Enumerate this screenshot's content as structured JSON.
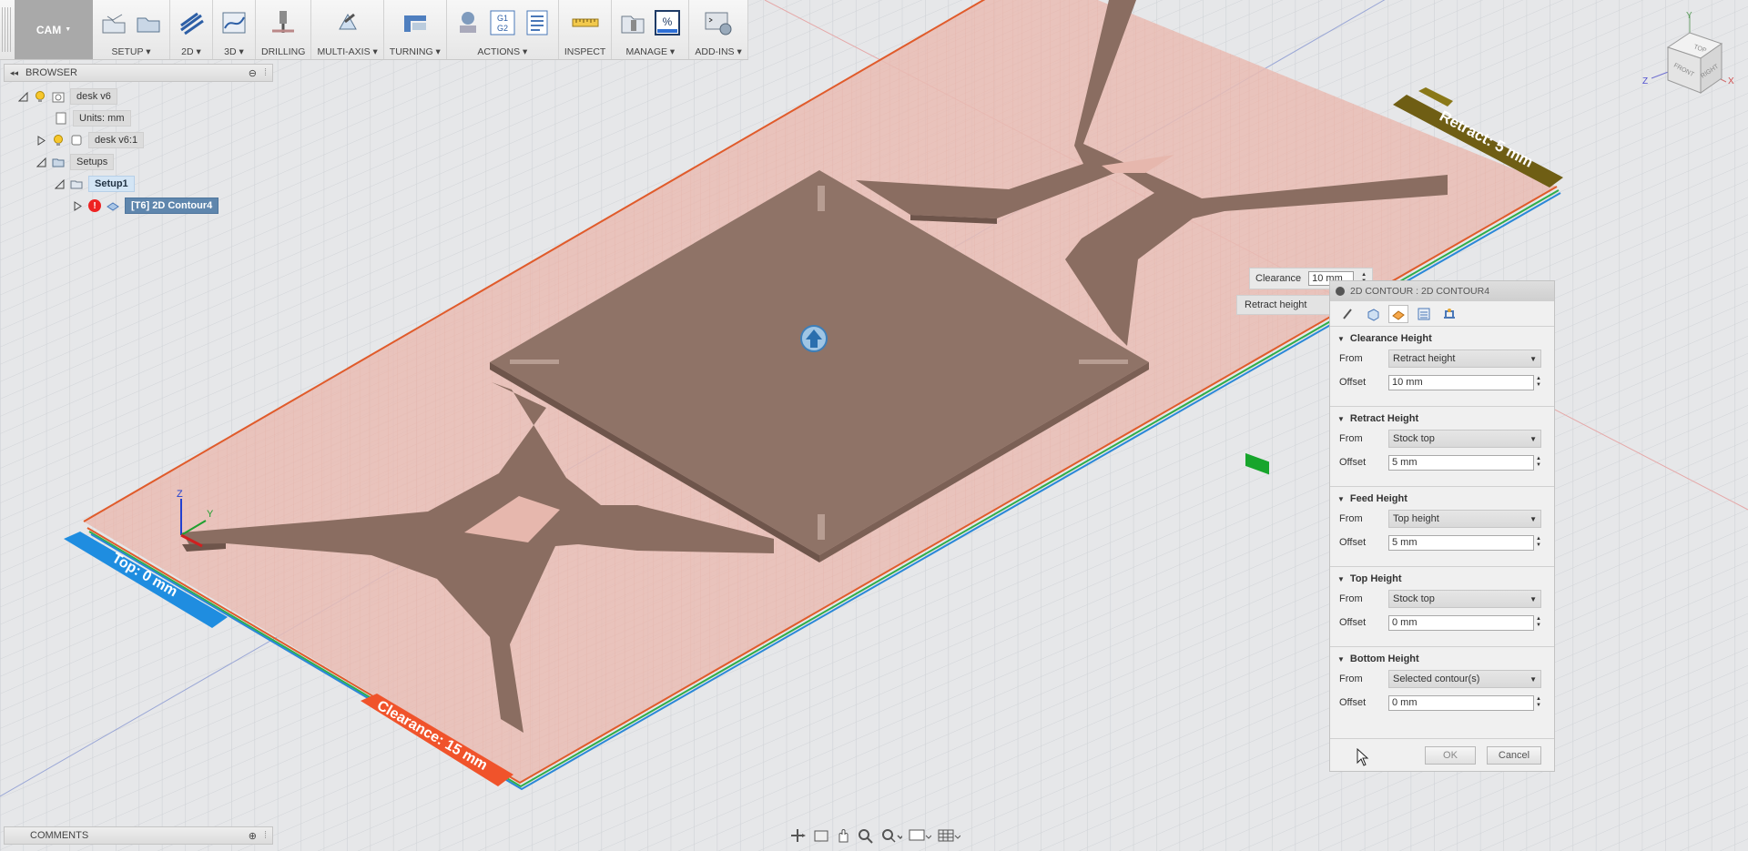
{
  "toolbar": {
    "workspace": "CAM",
    "groups": [
      {
        "label": "SETUP",
        "dropdown": true
      },
      {
        "label": "2D",
        "dropdown": true
      },
      {
        "label": "3D",
        "dropdown": true
      },
      {
        "label": "DRILLING",
        "dropdown": false
      },
      {
        "label": "MULTI-AXIS",
        "dropdown": true
      },
      {
        "label": "TURNING",
        "dropdown": true
      },
      {
        "label": "ACTIONS",
        "dropdown": true
      },
      {
        "label": "INSPECT",
        "dropdown": false
      },
      {
        "label": "MANAGE",
        "dropdown": true
      },
      {
        "label": "ADD-INS",
        "dropdown": true
      }
    ],
    "gcode_icon": {
      "line1": "G1",
      "line2": "G2"
    },
    "percent_icon": "%"
  },
  "browser": {
    "title": "BROWSER",
    "nodes": [
      {
        "label": "desk v6"
      },
      {
        "label": "Units: mm"
      },
      {
        "label": "desk v6:1"
      },
      {
        "label": "Setups"
      },
      {
        "label": "Setup1"
      },
      {
        "label": "[T6] 2D Contour4",
        "error": "!"
      }
    ]
  },
  "comments": {
    "title": "COMMENTS"
  },
  "viewport": {
    "labels": {
      "retract": "Retract: 5 mm",
      "top": "Top: 0 mm",
      "clearance": "Clearance: 15 mm"
    },
    "axis": {
      "z": "Z",
      "y": "Y"
    }
  },
  "viewcube": {
    "top": "TOP",
    "front": "FRONT",
    "right": "RIGHT",
    "x": "X",
    "y": "Y",
    "z": "Z"
  },
  "tooltip": {
    "clearance_label": "Clearance",
    "clearance_value": "10 mm",
    "retract_label": "Retract height"
  },
  "dialog": {
    "title": "2D CONTOUR : 2D CONTOUR4",
    "sections": [
      {
        "title": "Clearance Height",
        "from_label": "From",
        "from": "Retract height",
        "offset_label": "Offset",
        "offset": "10 mm"
      },
      {
        "title": "Retract Height",
        "from_label": "From",
        "from": "Stock top",
        "offset_label": "Offset",
        "offset": "5 mm"
      },
      {
        "title": "Feed Height",
        "from_label": "From",
        "from": "Top height",
        "offset_label": "Offset",
        "offset": "5 mm"
      },
      {
        "title": "Top Height",
        "from_label": "From",
        "from": "Stock top",
        "offset_label": "Offset",
        "offset": "0 mm"
      },
      {
        "title": "Bottom Height",
        "from_label": "From",
        "from": "Selected contour(s)",
        "offset_label": "Offset",
        "offset": "0 mm"
      }
    ],
    "ok": "OK",
    "cancel": "Cancel"
  }
}
